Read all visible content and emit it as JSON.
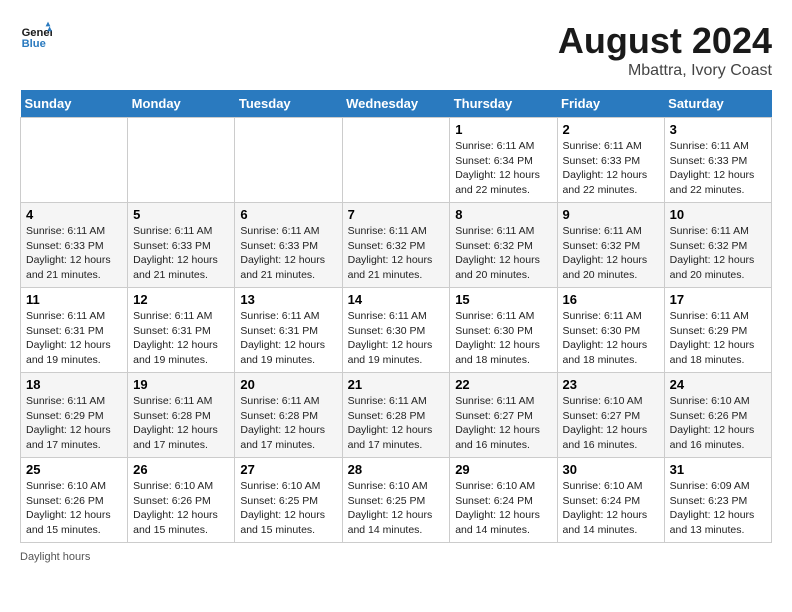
{
  "header": {
    "logo_line1": "General",
    "logo_line2": "Blue",
    "month": "August 2024",
    "location": "Mbattra, Ivory Coast"
  },
  "days_of_week": [
    "Sunday",
    "Monday",
    "Tuesday",
    "Wednesday",
    "Thursday",
    "Friday",
    "Saturday"
  ],
  "footer_text": "Daylight hours",
  "weeks": [
    [
      {
        "day": "",
        "info": ""
      },
      {
        "day": "",
        "info": ""
      },
      {
        "day": "",
        "info": ""
      },
      {
        "day": "",
        "info": ""
      },
      {
        "day": "1",
        "info": "Sunrise: 6:11 AM\nSunset: 6:34 PM\nDaylight: 12 hours\nand 22 minutes."
      },
      {
        "day": "2",
        "info": "Sunrise: 6:11 AM\nSunset: 6:33 PM\nDaylight: 12 hours\nand 22 minutes."
      },
      {
        "day": "3",
        "info": "Sunrise: 6:11 AM\nSunset: 6:33 PM\nDaylight: 12 hours\nand 22 minutes."
      }
    ],
    [
      {
        "day": "4",
        "info": "Sunrise: 6:11 AM\nSunset: 6:33 PM\nDaylight: 12 hours\nand 21 minutes."
      },
      {
        "day": "5",
        "info": "Sunrise: 6:11 AM\nSunset: 6:33 PM\nDaylight: 12 hours\nand 21 minutes."
      },
      {
        "day": "6",
        "info": "Sunrise: 6:11 AM\nSunset: 6:33 PM\nDaylight: 12 hours\nand 21 minutes."
      },
      {
        "day": "7",
        "info": "Sunrise: 6:11 AM\nSunset: 6:32 PM\nDaylight: 12 hours\nand 21 minutes."
      },
      {
        "day": "8",
        "info": "Sunrise: 6:11 AM\nSunset: 6:32 PM\nDaylight: 12 hours\nand 20 minutes."
      },
      {
        "day": "9",
        "info": "Sunrise: 6:11 AM\nSunset: 6:32 PM\nDaylight: 12 hours\nand 20 minutes."
      },
      {
        "day": "10",
        "info": "Sunrise: 6:11 AM\nSunset: 6:32 PM\nDaylight: 12 hours\nand 20 minutes."
      }
    ],
    [
      {
        "day": "11",
        "info": "Sunrise: 6:11 AM\nSunset: 6:31 PM\nDaylight: 12 hours\nand 19 minutes."
      },
      {
        "day": "12",
        "info": "Sunrise: 6:11 AM\nSunset: 6:31 PM\nDaylight: 12 hours\nand 19 minutes."
      },
      {
        "day": "13",
        "info": "Sunrise: 6:11 AM\nSunset: 6:31 PM\nDaylight: 12 hours\nand 19 minutes."
      },
      {
        "day": "14",
        "info": "Sunrise: 6:11 AM\nSunset: 6:30 PM\nDaylight: 12 hours\nand 19 minutes."
      },
      {
        "day": "15",
        "info": "Sunrise: 6:11 AM\nSunset: 6:30 PM\nDaylight: 12 hours\nand 18 minutes."
      },
      {
        "day": "16",
        "info": "Sunrise: 6:11 AM\nSunset: 6:30 PM\nDaylight: 12 hours\nand 18 minutes."
      },
      {
        "day": "17",
        "info": "Sunrise: 6:11 AM\nSunset: 6:29 PM\nDaylight: 12 hours\nand 18 minutes."
      }
    ],
    [
      {
        "day": "18",
        "info": "Sunrise: 6:11 AM\nSunset: 6:29 PM\nDaylight: 12 hours\nand 17 minutes."
      },
      {
        "day": "19",
        "info": "Sunrise: 6:11 AM\nSunset: 6:28 PM\nDaylight: 12 hours\nand 17 minutes."
      },
      {
        "day": "20",
        "info": "Sunrise: 6:11 AM\nSunset: 6:28 PM\nDaylight: 12 hours\nand 17 minutes."
      },
      {
        "day": "21",
        "info": "Sunrise: 6:11 AM\nSunset: 6:28 PM\nDaylight: 12 hours\nand 17 minutes."
      },
      {
        "day": "22",
        "info": "Sunrise: 6:11 AM\nSunset: 6:27 PM\nDaylight: 12 hours\nand 16 minutes."
      },
      {
        "day": "23",
        "info": "Sunrise: 6:10 AM\nSunset: 6:27 PM\nDaylight: 12 hours\nand 16 minutes."
      },
      {
        "day": "24",
        "info": "Sunrise: 6:10 AM\nSunset: 6:26 PM\nDaylight: 12 hours\nand 16 minutes."
      }
    ],
    [
      {
        "day": "25",
        "info": "Sunrise: 6:10 AM\nSunset: 6:26 PM\nDaylight: 12 hours\nand 15 minutes."
      },
      {
        "day": "26",
        "info": "Sunrise: 6:10 AM\nSunset: 6:26 PM\nDaylight: 12 hours\nand 15 minutes."
      },
      {
        "day": "27",
        "info": "Sunrise: 6:10 AM\nSunset: 6:25 PM\nDaylight: 12 hours\nand 15 minutes."
      },
      {
        "day": "28",
        "info": "Sunrise: 6:10 AM\nSunset: 6:25 PM\nDaylight: 12 hours\nand 14 minutes."
      },
      {
        "day": "29",
        "info": "Sunrise: 6:10 AM\nSunset: 6:24 PM\nDaylight: 12 hours\nand 14 minutes."
      },
      {
        "day": "30",
        "info": "Sunrise: 6:10 AM\nSunset: 6:24 PM\nDaylight: 12 hours\nand 14 minutes."
      },
      {
        "day": "31",
        "info": "Sunrise: 6:09 AM\nSunset: 6:23 PM\nDaylight: 12 hours\nand 13 minutes."
      }
    ]
  ]
}
